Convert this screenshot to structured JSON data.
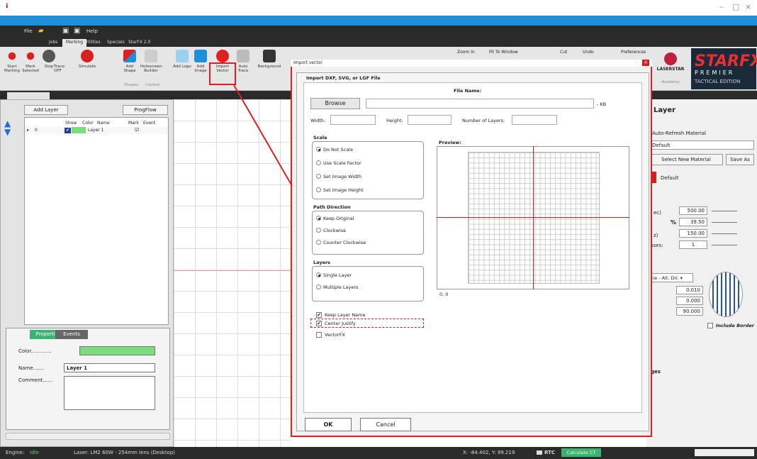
{
  "window": {
    "minimize": "–",
    "maximize": "▢",
    "close": "×"
  },
  "quick_access": {
    "file": "File",
    "help": "Help"
  },
  "tabs": [
    "Jobs",
    "Marking",
    "Utilities",
    "Specials",
    "StarFX 2.0"
  ],
  "ribbon": {
    "start_marking": "Start Marking",
    "mark_selected": "Mark Selected",
    "stop": "Stop",
    "trace": "Trace: OFF",
    "simulate": "Simulate",
    "add_shape": "Add Shape",
    "holoscreen_builder": "Holoscreen Builder",
    "add_logo": "Add Logo",
    "add_image": "Add Image",
    "import_vector": "Import Vector",
    "auto_trace": "Auto Trace",
    "background": "Background",
    "group_shapes": "Shapes",
    "group_control": "Control",
    "zoom_in": "Zoom In",
    "fit_to_window": "Fit To Window",
    "cut": "Cut",
    "undo": "Undo",
    "preferences": "Preferences",
    "academy": "Academy"
  },
  "brand": {
    "name": "STARFX",
    "premier": "PREMIER",
    "edition": "TACTICAL EDITION",
    "laserstar": "LASERSTAR"
  },
  "left": {
    "add_layer": "Add Layer",
    "progflow": "ProgFlow",
    "columns": [
      "Show",
      "Color",
      "Name",
      "Mark",
      "Event"
    ],
    "layer_row": {
      "index": "0",
      "name": "Layer 1"
    },
    "props_tab": "Properties",
    "events_tab": "Events",
    "color_label": "Color.............",
    "name_label": "Name.......",
    "name_value": "Layer 1",
    "comment_label": "Comment......"
  },
  "right": {
    "title": "Layer",
    "auto_refresh": "Auto-Refresh Material",
    "material_default": "Default",
    "select_material": "Select New Material",
    "save_as": "Save As",
    "material_name": "Default",
    "speed_suffix": "ec)",
    "speed": "500.00",
    "power_unit": "%",
    "power": "39.50",
    "freq_suffix": "z)",
    "freq": "150.00",
    "passes_suffix": "sses:",
    "passes": "1",
    "fill_mode": "ne - Alt. Dir.",
    "val1": "0.010",
    "val2": "0.000",
    "val3": "90.000",
    "include_border": "Include Border",
    "ges": "ges"
  },
  "dialog": {
    "title": "Import vector",
    "heading": "Import DXF, SVG, or LGF File",
    "file_name": "File Name:",
    "browse": "Browse",
    "kb": "- KB",
    "width": "Width:",
    "height": "Height:",
    "num_layers": "Number of Layers:",
    "scale_title": "Scale",
    "scale_opts": [
      "Do Not Scale",
      "Use Scale Factor",
      "Set Image Width",
      "Set Image Height"
    ],
    "path_title": "Path Direction",
    "path_opts": [
      "Keep Original",
      "Clockwise",
      "Counter Clockwise"
    ],
    "layers_title": "Layers",
    "layers_opts": [
      "Single Layer",
      "Multiple Layers"
    ],
    "preview": "Preview:",
    "origin": "0, 0",
    "keep_layer_name": "Keep Layer Name",
    "center_justify": "Center Justify",
    "vectorfx": "VectorFX",
    "ok": "OK",
    "cancel": "Cancel"
  },
  "status": {
    "engine_label": "Engine:",
    "engine_value": "Idle",
    "laser": "Laser: LM2 60W - 254mm lens (Desktop)",
    "coords": "X: -84.402, Y: 99.219",
    "rtc": "RTC",
    "calc": "Calculate CT"
  },
  "colors": {
    "accent": "#1e8fd8",
    "highlight": "#e02020",
    "layer_green": "#7ddc7d",
    "tab_green": "#3cb371"
  }
}
